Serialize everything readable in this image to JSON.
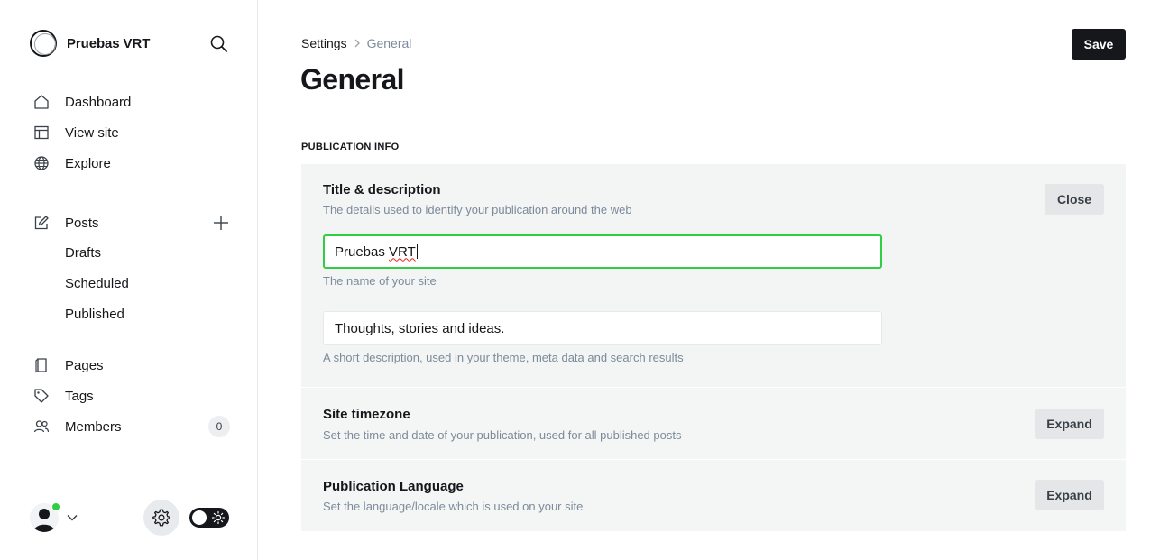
{
  "app": {
    "site_name": "Pruebas VRT"
  },
  "sidebar": {
    "nav_main": [
      {
        "label": "Dashboard",
        "icon": "home-icon"
      },
      {
        "label": "View site",
        "icon": "layout-icon"
      },
      {
        "label": "Explore",
        "icon": "globe-icon"
      }
    ],
    "posts": {
      "label": "Posts",
      "icon": "edit-icon"
    },
    "posts_sub": [
      "Drafts",
      "Scheduled",
      "Published"
    ],
    "nav_secondary": [
      {
        "label": "Pages",
        "icon": "page-icon"
      },
      {
        "label": "Tags",
        "icon": "tag-icon"
      },
      {
        "label": "Members",
        "icon": "members-icon",
        "count": "0"
      }
    ]
  },
  "header": {
    "breadcrumb_parent": "Settings",
    "breadcrumb_current": "General",
    "title": "General",
    "save_label": "Save"
  },
  "section": {
    "label": "PUBLICATION INFO"
  },
  "panels": {
    "title_desc": {
      "title": "Title & description",
      "description": "The details used to identify your publication around the web",
      "button": "Close",
      "site_title_value_plain": "Pruebas ",
      "site_title_value_misspelled": "VRT",
      "site_title_hint": "The name of your site",
      "site_desc_value": "Thoughts, stories and ideas.",
      "site_desc_hint": "A short description, used in your theme, meta data and search results"
    },
    "timezone": {
      "title": "Site timezone",
      "description": "Set the time and date of your publication, used for all published posts",
      "button": "Expand"
    },
    "language": {
      "title": "Publication Language",
      "description": "Set the language/locale which is used on your site",
      "button": "Expand"
    }
  },
  "colors": {
    "accent_green": "#30cf43",
    "primary_dark": "#15171a",
    "muted_text": "#7c8b9a"
  }
}
